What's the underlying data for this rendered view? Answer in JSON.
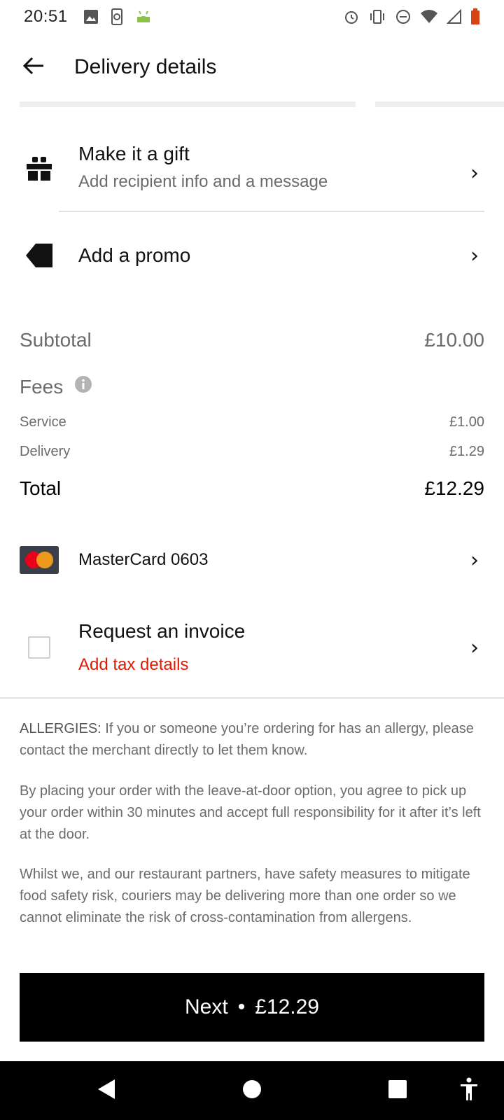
{
  "status_bar": {
    "time": "20:51",
    "left_icons": [
      "image-icon",
      "phone-sync-icon",
      "android-icon"
    ],
    "right_icons": [
      "alarm-icon",
      "vibrate-icon",
      "dnd-icon",
      "wifi-icon",
      "signal-icon",
      "battery-icon"
    ]
  },
  "header": {
    "title": "Delivery details",
    "back_icon": "arrow-left-icon"
  },
  "gift": {
    "title": "Make it a gift",
    "subtitle": "Add recipient info and a message",
    "icon": "gift-icon"
  },
  "promo": {
    "title": "Add a promo",
    "icon": "tag-icon"
  },
  "summary": {
    "subtotal_label": "Subtotal",
    "subtotal_value": "£10.00",
    "fees_label": "Fees",
    "service_label": "Service",
    "service_value": "£1.00",
    "delivery_label": "Delivery",
    "delivery_value": "£1.29",
    "total_label": "Total",
    "total_value": "£12.29"
  },
  "payment": {
    "card_label": "MasterCard 0603",
    "icon": "mastercard-icon"
  },
  "invoice": {
    "title": "Request an invoice",
    "subtitle": "Add tax details",
    "checked": false,
    "accent_color": "#e11900"
  },
  "disclaimers": {
    "allergies_label": "ALLERGIES:",
    "allergies_text": " If you or someone you’re ordering for has an allergy, please contact the merchant directly to let them know.",
    "leave_at_door": "By placing your order with the leave-at-door option, you agree to pick up your order within 30 minutes and accept full responsibility for it after it’s left at the door.",
    "safety": "Whilst we, and our restaurant partners, have safety measures to mitigate food safety risk, couriers may be delivering more than one order so we cannot eliminate the risk of cross-contamination from allergens."
  },
  "cta": {
    "label": "Next",
    "separator": "•",
    "amount": "£12.29"
  },
  "nav_bar": {
    "icons": [
      "nav-back-icon",
      "nav-home-icon",
      "nav-recents-icon",
      "accessibility-icon"
    ]
  },
  "chevron_glyph": "›"
}
